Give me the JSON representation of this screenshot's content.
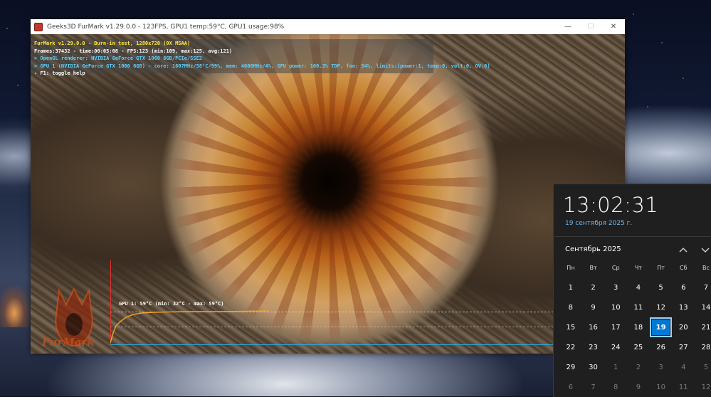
{
  "window": {
    "title": "Geeks3D FurMark v1.29.0.0 - 123FPS, GPU1 temp:59°C, GPU1 usage:98%",
    "controls": {
      "minimize": "—",
      "maximize": "☐",
      "close": "✕"
    }
  },
  "hud": {
    "line1": "FurMark v1.29.0.0 - Burn-in test, 1280x720 (0X MSAA)",
    "line2": "Frames:37432 - time:00:05:08 - FPS:123 (min:109, max:125, avg:121)",
    "line3": "> OpenGL renderer: NVIDIA GeForce GTX 1060 6GB/PCIe/SSE2",
    "line4": "> GPU 1 (NVIDIA GeForce GTX 1060 6GB) - core: 1607MHz/58°C/99%, mem: 4006MHz/4%, GPU power: 100.3% TDP, fan: 54%, limits:[power:1, temp:0, volt:0, OV:0]",
    "line5": "- F1: toggle help"
  },
  "graph": {
    "label": "GPU 1: 59°C (min: 32°C - max: 59°C)",
    "current_temp_c": 59,
    "min_temp_c": 32,
    "max_temp_c": 59
  },
  "logo": {
    "text": "FurMark"
  },
  "colors": {
    "hud_yellow": "#ffea3a",
    "hud_cyan": "#5fd0ff",
    "graph_line": "#f0a020",
    "accent": "#0078d4",
    "date_link": "#76b9ed"
  },
  "flyout": {
    "time": "13:02:31",
    "date": "19 сентября 2025 г.",
    "month": "Сентябрь 2025",
    "weekdays": [
      "Пн",
      "Вт",
      "Ср",
      "Чт",
      "Пт",
      "Сб",
      "Вс"
    ],
    "today": "19",
    "weeks": [
      [
        {
          "d": "1"
        },
        {
          "d": "2"
        },
        {
          "d": "3"
        },
        {
          "d": "4"
        },
        {
          "d": "5"
        },
        {
          "d": "6"
        },
        {
          "d": "7"
        }
      ],
      [
        {
          "d": "8"
        },
        {
          "d": "9"
        },
        {
          "d": "10"
        },
        {
          "d": "11"
        },
        {
          "d": "12"
        },
        {
          "d": "13"
        },
        {
          "d": "14"
        }
      ],
      [
        {
          "d": "15"
        },
        {
          "d": "16"
        },
        {
          "d": "17"
        },
        {
          "d": "18"
        },
        {
          "d": "19",
          "today": true
        },
        {
          "d": "20"
        },
        {
          "d": "21"
        }
      ],
      [
        {
          "d": "22"
        },
        {
          "d": "23"
        },
        {
          "d": "24"
        },
        {
          "d": "25"
        },
        {
          "d": "26"
        },
        {
          "d": "27"
        },
        {
          "d": "28"
        }
      ],
      [
        {
          "d": "29"
        },
        {
          "d": "30"
        },
        {
          "d": "1",
          "dim": true
        },
        {
          "d": "2",
          "dim": true
        },
        {
          "d": "3",
          "dim": true
        },
        {
          "d": "4",
          "dim": true
        },
        {
          "d": "5",
          "dim": true
        }
      ],
      [
        {
          "d": "6",
          "dim": true
        },
        {
          "d": "7",
          "dim": true
        },
        {
          "d": "8",
          "dim": true
        },
        {
          "d": "9",
          "dim": true
        },
        {
          "d": "10",
          "dim": true
        },
        {
          "d": "11",
          "dim": true
        },
        {
          "d": "12",
          "dim": true
        }
      ]
    ]
  }
}
